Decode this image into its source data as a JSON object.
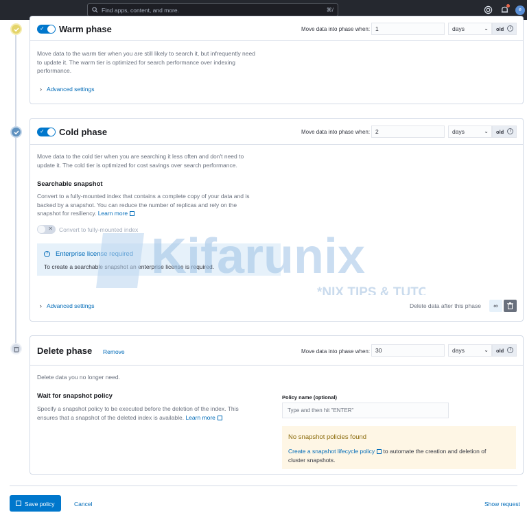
{
  "search": {
    "placeholder": "Find apps, content, and more.",
    "shortcut": "⌘/"
  },
  "header": {
    "avatar_initial": "e"
  },
  "warm": {
    "title": "Warm phase",
    "move_label": "Move data into phase when:",
    "value": "1",
    "unit": "days",
    "badge": "old",
    "description_1": "Move data to the warm tier when you are still likely to search it, but infrequently need",
    "description_2": "to update it. The warm tier is optimized for search performance over indexing",
    "description_3": "performance.",
    "advanced": "Advanced settings"
  },
  "cold": {
    "title": "Cold phase",
    "move_label": "Move data into phase when:",
    "value": "2",
    "unit": "days",
    "badge": "old",
    "description_1": "Move data to the cold tier when you are searching it less often and don't need to",
    "description_2": "update it. The cold tier is optimized for cost savings over search performance.",
    "snapshot_heading": "Searchable snapshot",
    "snapshot_desc_1": "Convert to a fully-mounted index that contains a complete copy of your data and is",
    "snapshot_desc_2": "backed by a snapshot. You can reduce the number of replicas and rely on the",
    "snapshot_desc_3": "snapshot for resiliency.",
    "learn_more": "Learn more",
    "convert_label": "Convert to fully-mounted index",
    "license_title": "Enterprise license required",
    "license_body": "To create a searchable snapshot an enterprise license is required.",
    "advanced": "Advanced settings",
    "delete_after": "Delete data after this phase",
    "infinity": "∞"
  },
  "delete": {
    "title": "Delete phase",
    "remove": "Remove",
    "move_label": "Move data into phase when:",
    "value": "30",
    "unit": "days",
    "badge": "old",
    "description": "Delete data you no longer need.",
    "wait_heading": "Wait for snapshot policy",
    "wait_desc_1": "Specify a snapshot policy to be executed before the deletion of the index. This",
    "wait_desc_2": "ensures that a snapshot of the deleted index is available.",
    "learn_more": "Learn more",
    "policy_label": "Policy name (optional)",
    "policy_placeholder": "Type and then hit \"ENTER\"",
    "warn_title": "No snapshot policies found",
    "warn_link": "Create a snapshot lifecycle policy",
    "warn_body_1": " to automate the creation and deletion of",
    "warn_body_2": "cluster snapshots."
  },
  "footer": {
    "save": "Save policy",
    "cancel": "Cancel",
    "show_request": "Show request"
  },
  "watermark": {
    "brand": "Kifarunix",
    "tagline": "*NIX TIPS & TUTORIALS"
  },
  "colors": {
    "primary": "#0077cc",
    "link": "#006bb8",
    "warm_step": "#e4d46a",
    "cold_step": "#6092c0"
  }
}
